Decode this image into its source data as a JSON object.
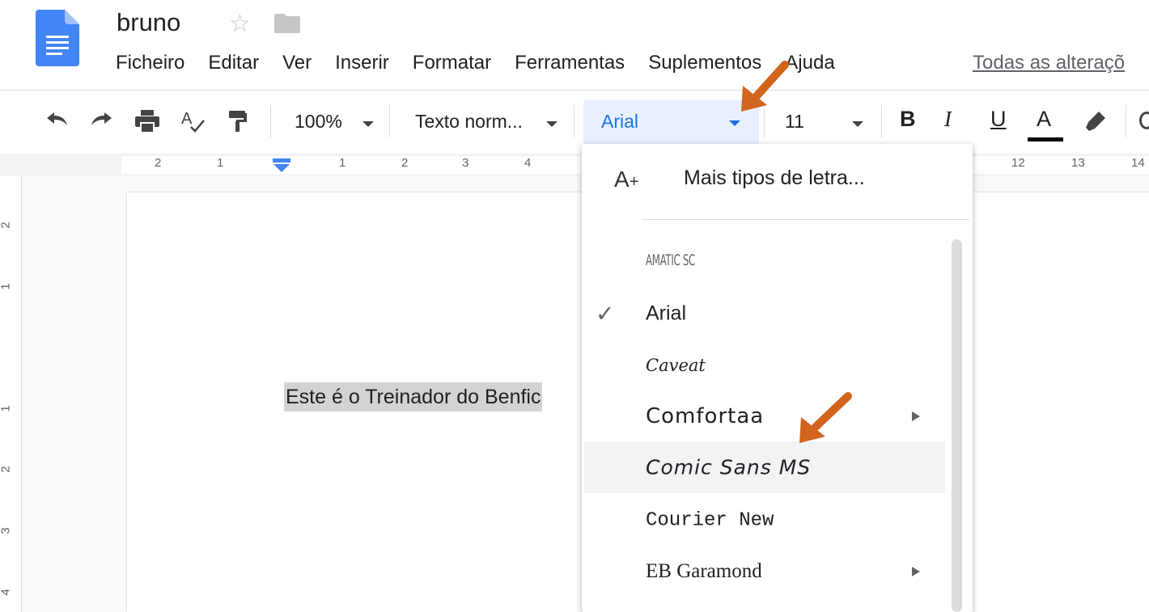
{
  "document": {
    "title": "Bruno"
  },
  "header": {
    "title": "bruno",
    "menu": [
      "Ficheiro",
      "Editar",
      "Ver",
      "Inserir",
      "Formatar",
      "Ferramentas",
      "Suplementos",
      "Ajuda"
    ],
    "status": "Todas as alteraçõ"
  },
  "toolbar": {
    "zoom": "100%",
    "style": "Texto norm...",
    "font": "Arial",
    "size": "11",
    "bold": "B",
    "italic": "I",
    "underline": "U",
    "text_color": "A"
  },
  "ruler": {
    "horizontal": [
      "2",
      "1",
      "1",
      "2",
      "3",
      "4",
      "12",
      "13",
      "14"
    ],
    "vertical": [
      "2",
      "1",
      "1",
      "2",
      "3",
      "4"
    ]
  },
  "body_text": "Este é o Treinador do Benfic",
  "font_menu": {
    "more": "Mais tipos de letra...",
    "fonts": [
      {
        "name": "Amatic SC",
        "display": "AMATIC SC"
      },
      {
        "name": "Arial",
        "display": "Arial",
        "selected": true
      },
      {
        "name": "Caveat",
        "display": "Caveat"
      },
      {
        "name": "Comfortaa",
        "display": "Comfortaa",
        "submenu": true
      },
      {
        "name": "Comic Sans MS",
        "display": "Comic Sans MS",
        "hovered": true
      },
      {
        "name": "Courier New",
        "display": "Courier New"
      },
      {
        "name": "EB Garamond",
        "display": "EB Garamond",
        "submenu": true
      }
    ]
  },
  "colors": {
    "accent": "#1a73e8",
    "font_box_bg": "#e8f0fe",
    "annotation_arrow": "#d2651e",
    "selection": "#d3d3d3"
  },
  "icons": [
    "docs-logo-icon",
    "star-icon",
    "folder-icon",
    "undo-icon",
    "redo-icon",
    "print-icon",
    "spellcheck-icon",
    "paint-format-icon",
    "highlighter-icon",
    "add-font-icon",
    "checkmark-icon"
  ]
}
